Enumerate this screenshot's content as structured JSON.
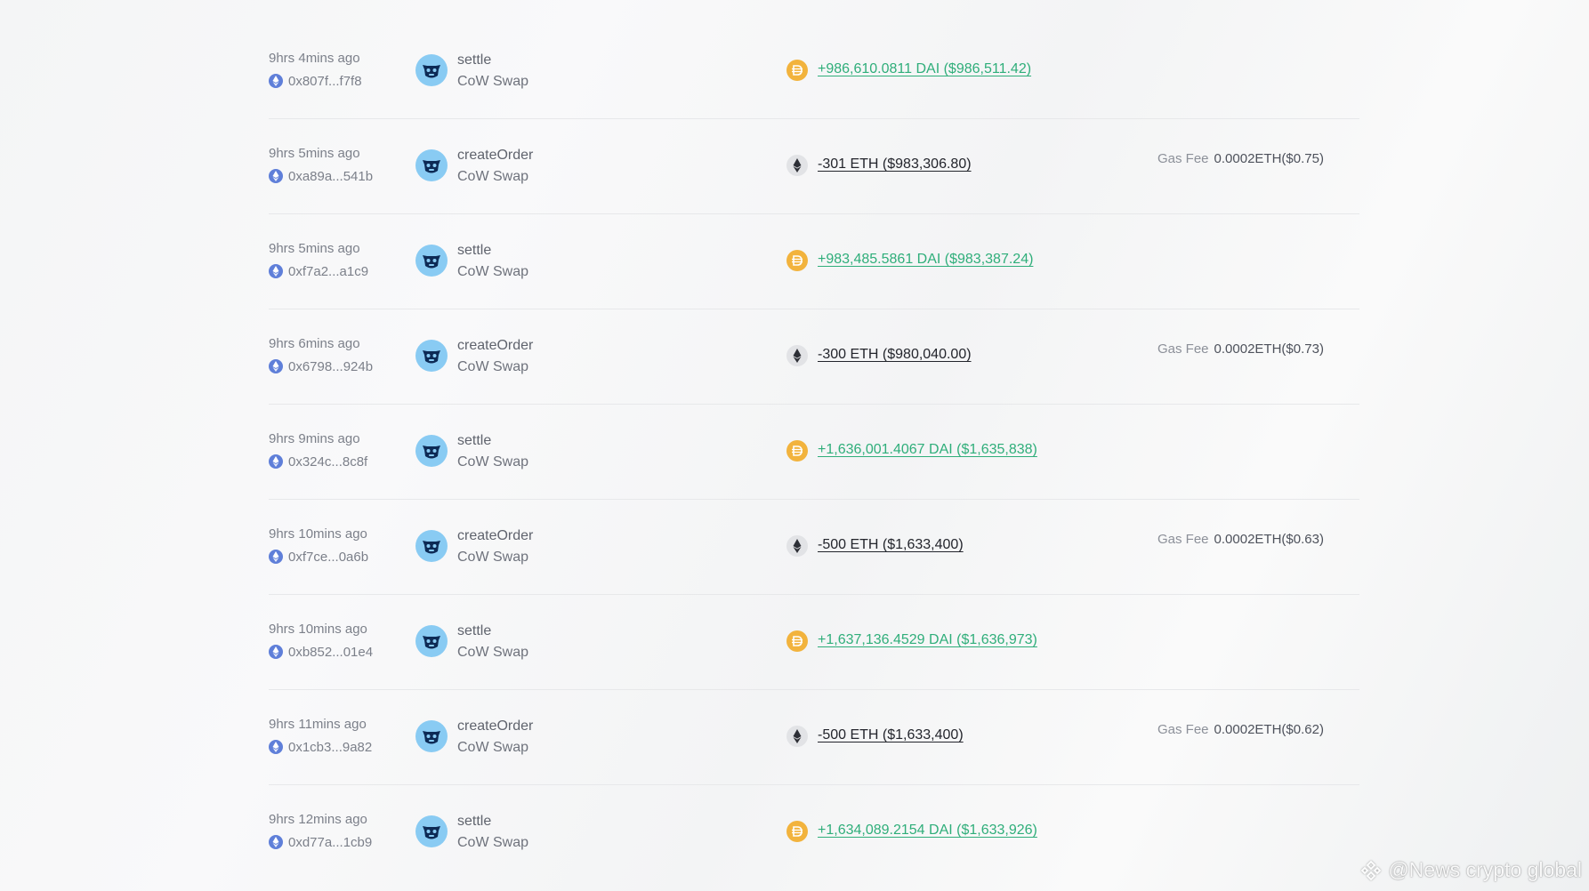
{
  "colors": {
    "incoming": "#2fae7a",
    "outgoing": "#23252c",
    "dai": "#f2b33d",
    "eth_bg": "#e2e3e6",
    "cow_bg": "#89cbf3",
    "chain": "#5f7fd9"
  },
  "icons": {
    "chain": "ethereum-chain-icon",
    "protocol": "cow-swap-icon",
    "dai": "dai-token-icon",
    "eth": "eth-token-icon"
  },
  "transactions": [
    {
      "time": "9hrs 4mins ago",
      "hash": "0x807f...f7f8",
      "method": "settle",
      "protocol": "CoW Swap",
      "direction": "in",
      "token": "dai",
      "amount": "+986,610.0811 DAI ($986,511.42)",
      "gas_label": "",
      "gas_value": ""
    },
    {
      "time": "9hrs 5mins ago",
      "hash": "0xa89a...541b",
      "method": "createOrder",
      "protocol": "CoW Swap",
      "direction": "out",
      "token": "eth",
      "amount": "-301 ETH ($983,306.80)",
      "gas_label": "Gas Fee",
      "gas_value": "0.0002ETH($0.75)"
    },
    {
      "time": "9hrs 5mins ago",
      "hash": "0xf7a2...a1c9",
      "method": "settle",
      "protocol": "CoW Swap",
      "direction": "in",
      "token": "dai",
      "amount": "+983,485.5861 DAI ($983,387.24)",
      "gas_label": "",
      "gas_value": ""
    },
    {
      "time": "9hrs 6mins ago",
      "hash": "0x6798...924b",
      "method": "createOrder",
      "protocol": "CoW Swap",
      "direction": "out",
      "token": "eth",
      "amount": "-300 ETH ($980,040.00)",
      "gas_label": "Gas Fee",
      "gas_value": "0.0002ETH($0.73)"
    },
    {
      "time": "9hrs 9mins ago",
      "hash": "0x324c...8c8f",
      "method": "settle",
      "protocol": "CoW Swap",
      "direction": "in",
      "token": "dai",
      "amount": "+1,636,001.4067 DAI ($1,635,838)",
      "gas_label": "",
      "gas_value": ""
    },
    {
      "time": "9hrs 10mins ago",
      "hash": "0xf7ce...0a6b",
      "method": "createOrder",
      "protocol": "CoW Swap",
      "direction": "out",
      "token": "eth",
      "amount": "-500 ETH ($1,633,400)",
      "gas_label": "Gas Fee",
      "gas_value": "0.0002ETH($0.63)"
    },
    {
      "time": "9hrs 10mins ago",
      "hash": "0xb852...01e4",
      "method": "settle",
      "protocol": "CoW Swap",
      "direction": "in",
      "token": "dai",
      "amount": "+1,637,136.4529 DAI ($1,636,973)",
      "gas_label": "",
      "gas_value": ""
    },
    {
      "time": "9hrs 11mins ago",
      "hash": "0x1cb3...9a82",
      "method": "createOrder",
      "protocol": "CoW Swap",
      "direction": "out",
      "token": "eth",
      "amount": "-500 ETH ($1,633,400)",
      "gas_label": "Gas Fee",
      "gas_value": "0.0002ETH($0.62)"
    },
    {
      "time": "9hrs 12mins ago",
      "hash": "0xd77a...1cb9",
      "method": "settle",
      "protocol": "CoW Swap",
      "direction": "in",
      "token": "dai",
      "amount": "+1,634,089.2154 DAI ($1,633,926)",
      "gas_label": "",
      "gas_value": ""
    }
  ],
  "watermark": {
    "text": "@News crypto global",
    "icon": "binance-logo-icon"
  }
}
